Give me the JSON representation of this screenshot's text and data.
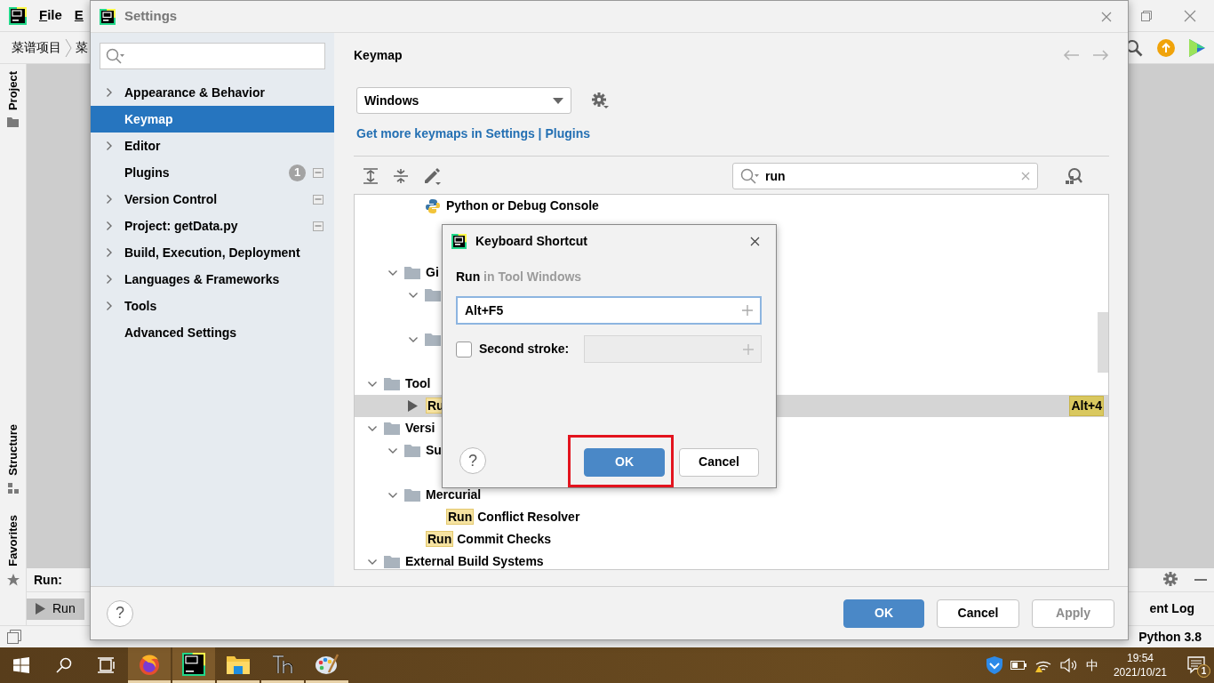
{
  "ide": {
    "menu": [
      "File",
      "E"
    ],
    "breadcrumb": [
      "菜谱项目",
      "菜"
    ],
    "side_tabs": [
      {
        "label": "Project"
      },
      {
        "label": "Structure"
      },
      {
        "label": "Favorites"
      }
    ],
    "run_panel": {
      "title": "Run:",
      "tab": "Run"
    },
    "event_log": "ent Log",
    "interpreter": "Python 3.8"
  },
  "settings": {
    "title": "Settings",
    "nav": [
      {
        "label": "Appearance & Behavior",
        "expandable": true,
        "selected": false,
        "project_scope": false
      },
      {
        "label": "Keymap",
        "expandable": false,
        "selected": true,
        "project_scope": false
      },
      {
        "label": "Editor",
        "expandable": true,
        "selected": false,
        "project_scope": false
      },
      {
        "label": "Plugins",
        "expandable": false,
        "selected": false,
        "badge": "1",
        "project_scope": true
      },
      {
        "label": "Version Control",
        "expandable": true,
        "selected": false,
        "project_scope": true
      },
      {
        "label": "Project: getData.py",
        "expandable": true,
        "selected": false,
        "project_scope": true
      },
      {
        "label": "Build, Execution, Deployment",
        "expandable": true,
        "selected": false,
        "project_scope": false
      },
      {
        "label": "Languages & Frameworks",
        "expandable": true,
        "selected": false,
        "project_scope": false
      },
      {
        "label": "Tools",
        "expandable": true,
        "selected": false,
        "project_scope": false
      },
      {
        "label": "Advanced Settings",
        "expandable": false,
        "selected": false,
        "project_scope": false
      }
    ],
    "page_title": "Keymap",
    "keymap": "Windows",
    "link": "Get more keymaps in Settings | Plugins",
    "search": {
      "value": "run"
    },
    "tree": [
      {
        "kind": "offscreen",
        "children": [
          {
            "kind": "offscreen",
            "children": [
              {
                "kind": "console",
                "label": "Python or Debug Console",
                "selected": false
              },
              {
                "kind": "covered"
              },
              {
                "kind": "covered"
              }
            ]
          },
          {
            "kind": "folder",
            "label": "Gi",
            "expanded": true,
            "selected": false,
            "children": [
              {
                "kind": "folder",
                "expanded": true,
                "selected": false,
                "children": [
                  {
                    "kind": "covered"
                  }
                ]
              },
              {
                "kind": "folder",
                "expanded": true,
                "selected": false,
                "children": [
                  {
                    "kind": "covered"
                  }
                ]
              }
            ]
          }
        ]
      },
      {
        "kind": "folder",
        "label": "Tool",
        "expanded": true,
        "selected": false,
        "children": [
          {
            "kind": "tool-window",
            "highlight": "Ru",
            "selected": true,
            "shortcut": "Alt+4"
          }
        ]
      },
      {
        "kind": "folder",
        "label": "Versi",
        "expanded": true,
        "selected": false,
        "children": [
          {
            "kind": "folder",
            "label": "Su",
            "expanded": true,
            "selected": false,
            "children": [
              {
                "kind": "covered"
              }
            ]
          },
          {
            "kind": "folder",
            "label": "Mercurial",
            "expanded": true,
            "selected": false,
            "children": [
              {
                "kind": "action",
                "highlight": "Run",
                "label": "Conflict Resolver",
                "selected": false
              }
            ]
          },
          {
            "kind": "action",
            "highlight": "Run",
            "label": "Commit Checks",
            "selected": false
          }
        ]
      },
      {
        "kind": "folder",
        "label": "External Build Systems",
        "expanded": true,
        "selected": false
      }
    ],
    "help": "?",
    "buttons": [
      {
        "label": "OK",
        "kind": "primary",
        "disabled": false
      },
      {
        "label": "Cancel",
        "kind": "default",
        "disabled": false
      },
      {
        "label": "Apply",
        "kind": "default",
        "disabled": true
      }
    ]
  },
  "shortcut_dialog": {
    "title": "Keyboard Shortcut",
    "action": "Run",
    "context": "in Tool Windows",
    "first_stroke": "Alt+F5",
    "second_stroke_label": "Second stroke:",
    "second_stroke_enabled": false,
    "help": "?",
    "buttons": [
      {
        "label": "OK",
        "kind": "primary",
        "annotated": true
      },
      {
        "label": "Cancel",
        "kind": "default",
        "annotated": false
      }
    ]
  },
  "taskbar": {
    "apps": [
      {
        "kind": "firefox",
        "highlighted": true,
        "running": true
      },
      {
        "kind": "pycharm",
        "highlighted": true,
        "running": true
      },
      {
        "kind": "explorer",
        "highlighted": false,
        "running": true
      },
      {
        "kind": "typora",
        "highlighted": false,
        "running": true
      },
      {
        "kind": "paint",
        "highlighted": false,
        "running": true
      }
    ],
    "ime": "中",
    "time": "19:54",
    "date": "2021/10/21",
    "notifications": "1"
  }
}
